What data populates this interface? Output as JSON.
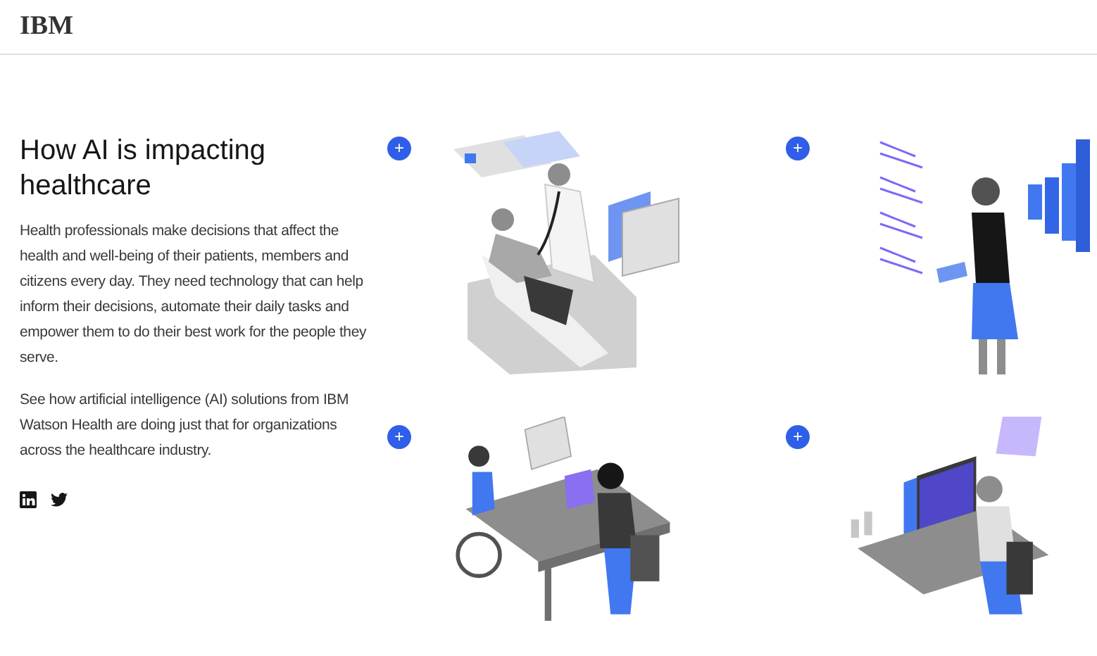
{
  "header": {
    "logo": "IBM"
  },
  "intro": {
    "title": "How AI is impacting healthcare",
    "paragraphs": [
      "Health professionals make decisions that affect the health and well-being of their patients, members and citizens every day. They need technology that can help inform their decisions, automate their daily tasks and empower them to do their best work for the people they serve.",
      "See how artificial intelligence (AI) solutions from IBM Watson Health are doing just that for organizations across the healthcare industry."
    ],
    "social": [
      {
        "kind": "linkedin"
      },
      {
        "kind": "twitter"
      }
    ]
  },
  "cards": [
    {
      "kind": "exam",
      "button": "+"
    },
    {
      "kind": "analyst",
      "button": "+"
    },
    {
      "kind": "desk",
      "button": "+"
    },
    {
      "kind": "monitor",
      "button": "+"
    }
  ]
}
